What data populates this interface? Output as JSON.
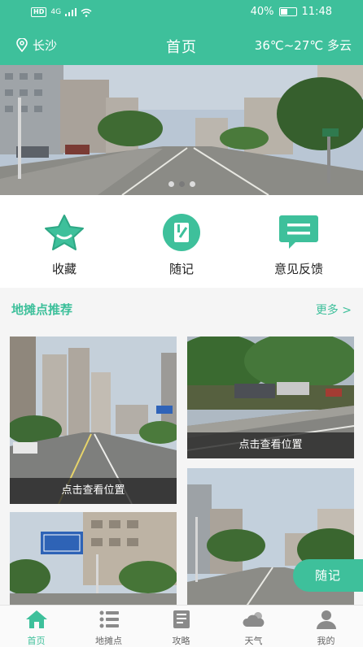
{
  "status_bar": {
    "network": "HD",
    "signal": "4G",
    "battery_text": "40%",
    "time": "11:48"
  },
  "header": {
    "city": "长沙",
    "title": "首页",
    "weather": "36℃~27℃ 多云"
  },
  "banner": {
    "slides": 3,
    "active": 1
  },
  "actions": [
    {
      "label": "收藏",
      "icon": "star-icon"
    },
    {
      "label": "随记",
      "icon": "note-icon"
    },
    {
      "label": "意见反馈",
      "icon": "feedback-icon"
    }
  ],
  "section": {
    "title": "地摊点推荐",
    "more": "更多 >"
  },
  "cards": [
    {
      "caption": "点击查看位置"
    },
    {
      "caption": "点击查看位置"
    },
    {
      "caption": ""
    },
    {
      "caption": ""
    }
  ],
  "float_button": {
    "label": "随记"
  },
  "tabs": [
    {
      "label": "首页",
      "icon": "home-icon",
      "active": true
    },
    {
      "label": "地摊点",
      "icon": "list-icon",
      "active": false
    },
    {
      "label": "攻略",
      "icon": "book-icon",
      "active": false
    },
    {
      "label": "天气",
      "icon": "cloud-icon",
      "active": false
    },
    {
      "label": "我的",
      "icon": "user-icon",
      "active": false
    }
  ],
  "colors": {
    "accent": "#3ec09b",
    "caption_bg": "#282828"
  }
}
